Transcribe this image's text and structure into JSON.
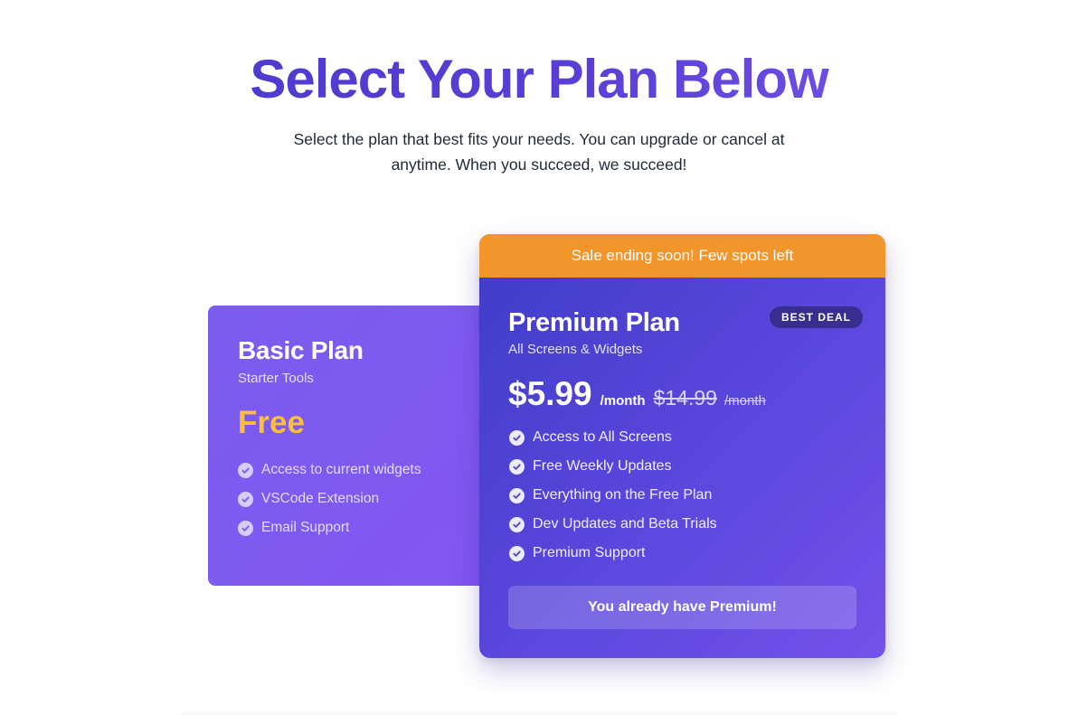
{
  "header": {
    "title": "Select Your Plan Below",
    "subtitle": "Select the plan that best fits your needs. You can upgrade or cancel at anytime. When you succeed, we succeed!"
  },
  "plans": {
    "basic": {
      "name": "Basic Plan",
      "tagline": "Starter Tools",
      "price": "Free",
      "features": [
        "Access to current widgets",
        "VSCode Extension",
        "Email Support"
      ]
    },
    "premium": {
      "banner": "Sale ending soon! Few spots left",
      "name": "Premium Plan",
      "tagline": "All Screens & Widgets",
      "badge": "BEST DEAL",
      "price": "$5.99",
      "period": "/month",
      "old_price": "$14.99",
      "old_period": "/month",
      "features": [
        "Access to All Screens",
        "Free Weekly Updates",
        "Everything on the Free Plan",
        "Dev Updates and Beta Trials",
        "Premium Support"
      ],
      "cta": "You already have Premium!"
    }
  },
  "colors": {
    "title_gradient_start": "#4338ca",
    "title_gradient_end": "#7c5cf0",
    "basic_card": "#7b5cee",
    "premium_card": "#4f43d4",
    "banner": "#f2952b",
    "free_price": "#fbbf3c"
  },
  "icons": {
    "feature_check": "check-circle-icon"
  }
}
